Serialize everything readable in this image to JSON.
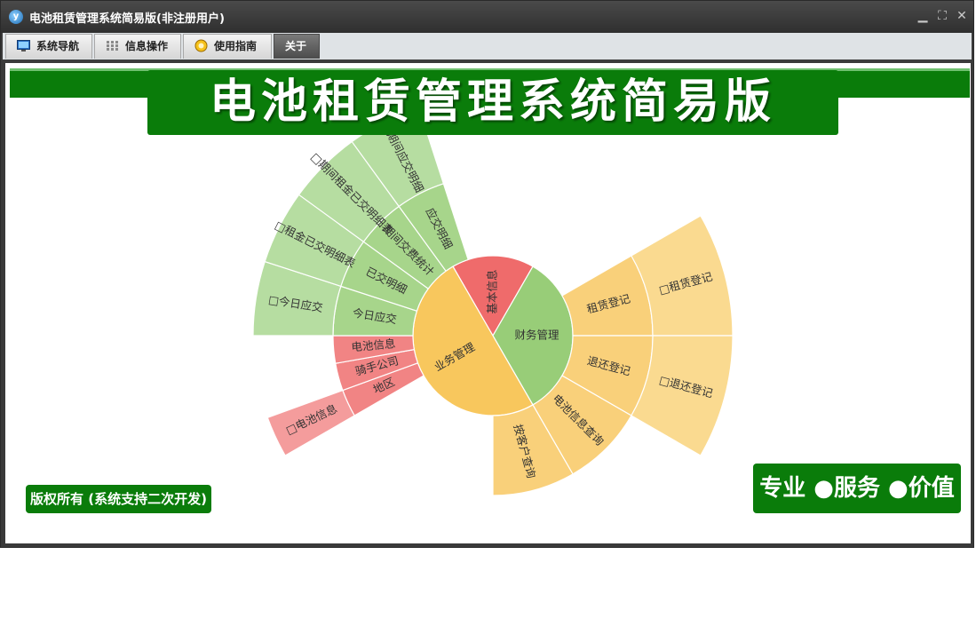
{
  "window": {
    "title": "电池租赁管理系统简易版(非注册用户)",
    "controls": {
      "minimize": "▁",
      "restore": "⛶",
      "close": "✕"
    }
  },
  "tabs": [
    {
      "label": "系统导航",
      "icon": "monitor-icon"
    },
    {
      "label": "信息操作",
      "icon": "grid-icon"
    },
    {
      "label": "使用指南",
      "icon": "guide-icon"
    },
    {
      "label": "关于",
      "active": true
    }
  ],
  "banner": {
    "title": "电池租赁管理系统简易版"
  },
  "footer": {
    "copyright": "版权所有 (系统支持二次开发)",
    "slogan": "专业 ●服务 ●价值"
  },
  "colors": {
    "brand_green": "#0a7c0a",
    "red": "#ef6b6b",
    "yellow": "#f8c75d",
    "green": "#98cd78"
  },
  "sunburst": {
    "categories": [
      {
        "label": "基本信息",
        "group": "red"
      },
      {
        "label": "财务管理",
        "group": "green"
      },
      {
        "label": "业务管理",
        "group": "yellow"
      }
    ],
    "level2": [
      {
        "label": "地区",
        "group": "red"
      },
      {
        "label": "骑手公司",
        "group": "red"
      },
      {
        "label": "电池信息",
        "group": "red"
      },
      {
        "label": "今日应交",
        "group": "green"
      },
      {
        "label": "已交明细",
        "group": "green"
      },
      {
        "label": "期间交费统计",
        "group": "green"
      },
      {
        "label": "应交明细",
        "group": "green"
      },
      {
        "label": "租赁登记",
        "group": "yellow"
      },
      {
        "label": "退还登记",
        "group": "yellow"
      },
      {
        "label": "电池信息查询",
        "group": "yellow"
      },
      {
        "label": "按客户查询",
        "group": "yellow"
      }
    ],
    "level3": [
      {
        "label": "□电池信息",
        "group": "red"
      },
      {
        "label": "□今日应交",
        "group": "green"
      },
      {
        "label": "□租金已交明细表",
        "group": "green"
      },
      {
        "label": "□期间租金已交明细表",
        "group": "green"
      },
      {
        "label": "□期间应交明细",
        "group": "green"
      },
      {
        "label": "□租赁登记",
        "group": "yellow"
      },
      {
        "label": "□退还登记",
        "group": "yellow"
      }
    ]
  }
}
